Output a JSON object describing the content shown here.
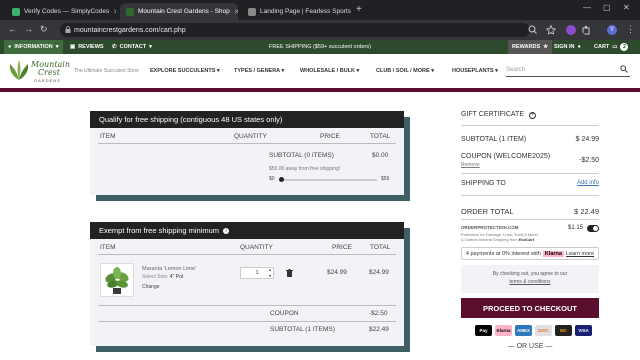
{
  "browser": {
    "tabs": [
      {
        "title": "Verify Codes — SimplyCodes",
        "active": false,
        "favicon_color": "#3cb371"
      },
      {
        "title": "Mountain Crest Gardens - Shop",
        "active": true,
        "favicon_color": "#2d6a2d"
      },
      {
        "title": "Landing Page | Fearless Sports",
        "active": false,
        "favicon_color": "#888888"
      }
    ],
    "url": "mountaincrestgardens.com/cart.php",
    "new_tab_glyph": "+",
    "back_glyph": "←",
    "forward_glyph": "→",
    "reload_glyph": "↻",
    "minimize_glyph": "—",
    "maximize_glyph": "▢",
    "close_glyph": "✕",
    "profile_initial": "Y"
  },
  "topstrip": {
    "information": "INFORMATION",
    "reviews": "REVIEWS",
    "contact": "CONTACT",
    "shipping_notice": "FREE SHIPPING ($59+ succulent orders)",
    "rewards": "REWARDS",
    "sign_in": "SIGN IN",
    "cart": "CART",
    "cart_count": "2"
  },
  "header": {
    "logo_line1": "Mountain",
    "logo_line2": "Crest",
    "logo_line3": "GARDENS",
    "tagline": "The Ultimate Succulent Store",
    "nav": [
      "EXPLORE SUCCULENTS",
      "TYPES / GENERA",
      "WHOLESALE / BULK",
      "CLUB / SOIL / MORE",
      "HOUSEPLANTS"
    ],
    "search_placeholder": "Search"
  },
  "panel_free": {
    "title": "Qualify for free shipping (contiguous 48 US states only)",
    "col_item": "ITEM",
    "col_quantity": "QUANTITY",
    "col_price": "PRICE",
    "col_total": "TOTAL",
    "subtotal_label": "SUBTOTAL (0 ITEMS)",
    "subtotal_value": "$0.00",
    "away_text": "$59.00 away from free shipping!",
    "progress_min": "$0",
    "progress_max": "$59",
    "progress_fraction": 0
  },
  "panel_exempt": {
    "title": "Exempt from free shipping minimum",
    "col_item": "ITEM",
    "col_quantity": "QUANTITY",
    "col_price": "PRICE",
    "col_total": "TOTAL",
    "item_name": "Maranta 'Lemon Lime'",
    "item_size_label": "Select Size:",
    "item_size_value": "4\" Pot",
    "item_change": "Change",
    "item_qty": "1",
    "item_price": "$24.99",
    "item_total": "$24.99",
    "coupon_label": "COUPON",
    "coupon_value": "-$2.50",
    "subtotal_label": "SUBTOTAL (1 ITEMS)",
    "subtotal_value": "$22.49"
  },
  "summary": {
    "gift_certificate": "GIFT CERTIFICATE",
    "subtotal_label": "SUBTOTAL (1 ITEM)",
    "subtotal_value": "$ 24.99",
    "coupon_label": "COUPON (WELCOME2025)",
    "coupon_value": "-$2.50",
    "coupon_remove": "Remove",
    "shipping_label": "SHIPPING TO",
    "shipping_action": "Add info",
    "order_total_label": "ORDER TOTAL",
    "order_total_value": "$ 22.49",
    "protection_brand": "ORDERPROTECTION.COM",
    "protection_price": "$1.15",
    "protection_desc": "Protection for Damage, Loss, Theft & More!",
    "protection_desc2": "& Carbon Neutral Shipping from",
    "protection_partner": "EcoCart",
    "klarna_text": "4 payments at 0% interest with",
    "klarna_brand": "Klarna",
    "klarna_learn": "Learn more",
    "agree_text": "By checking out, you agree to our",
    "terms_link": "terms & conditions",
    "checkout_button": "PROCEED TO CHECKOUT",
    "or_use": "— OR USE —",
    "pay_methods": [
      {
        "label": "Pay",
        "color": "#000000"
      },
      {
        "label": "Klarna",
        "color": "#ffb3c7"
      },
      {
        "label": "AMEX",
        "color": "#2e77bb"
      },
      {
        "label": "DISC",
        "color": "#e0e0e0"
      },
      {
        "label": "MC",
        "color": "#222222"
      },
      {
        "label": "VISA",
        "color": "#1a1f71"
      }
    ]
  }
}
